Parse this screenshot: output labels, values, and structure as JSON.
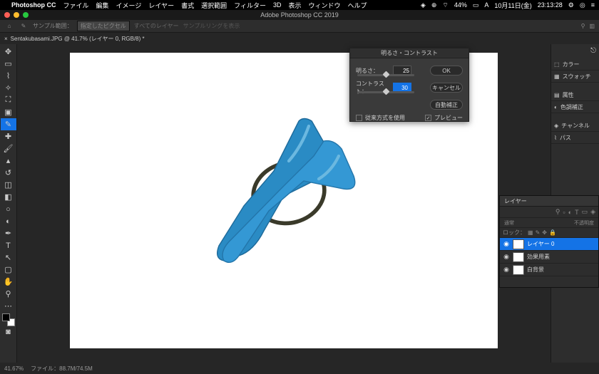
{
  "menubar": {
    "apple": "",
    "app": "Photoshop CC",
    "items": [
      "ファイル",
      "編集",
      "イメージ",
      "レイヤー",
      "書式",
      "選択範囲",
      "フィルター",
      "3D",
      "表示",
      "ウィンドウ",
      "ヘルプ"
    ],
    "battery": "44%",
    "date": "10月11日(金)",
    "time": "23:13:28"
  },
  "window": {
    "title": "Adobe Photoshop CC 2019"
  },
  "optbar": {
    "sample": "サンプル範囲：",
    "sampleval": "指定したピクセル",
    "layers": "すべてのレイヤー",
    "ring": "サンプルリングを表示"
  },
  "tab": {
    "label": "Sentakubasami.JPG @ 41.7% (レイヤー 0, RGB/8) *",
    "close": "×"
  },
  "dialog": {
    "title": "明るさ・コントラスト",
    "brightness_label": "明るさ：",
    "brightness": "25",
    "contrast_label": "コントラスト：",
    "contrast": "30",
    "ok": "OK",
    "cancel": "キャンセル",
    "auto": "自動補正",
    "legacy": "従来方式を使用",
    "preview": "プレビュー"
  },
  "rpanel": {
    "color": "カラー",
    "swatch": "スウォッチ",
    "prop": "属性",
    "adjust": "色調補正",
    "channel": "チャンネル",
    "path": "パス"
  },
  "layers": {
    "title": "レイヤー",
    "normal": "通常",
    "opacity": "不透明度",
    "lock": "ロック：",
    "layer0": "レイヤー 0",
    "effect": "効果用素",
    "bg": "白背景"
  },
  "status": {
    "zoom": "41.67%",
    "file": "ファイル：88.7M/74.5M"
  }
}
